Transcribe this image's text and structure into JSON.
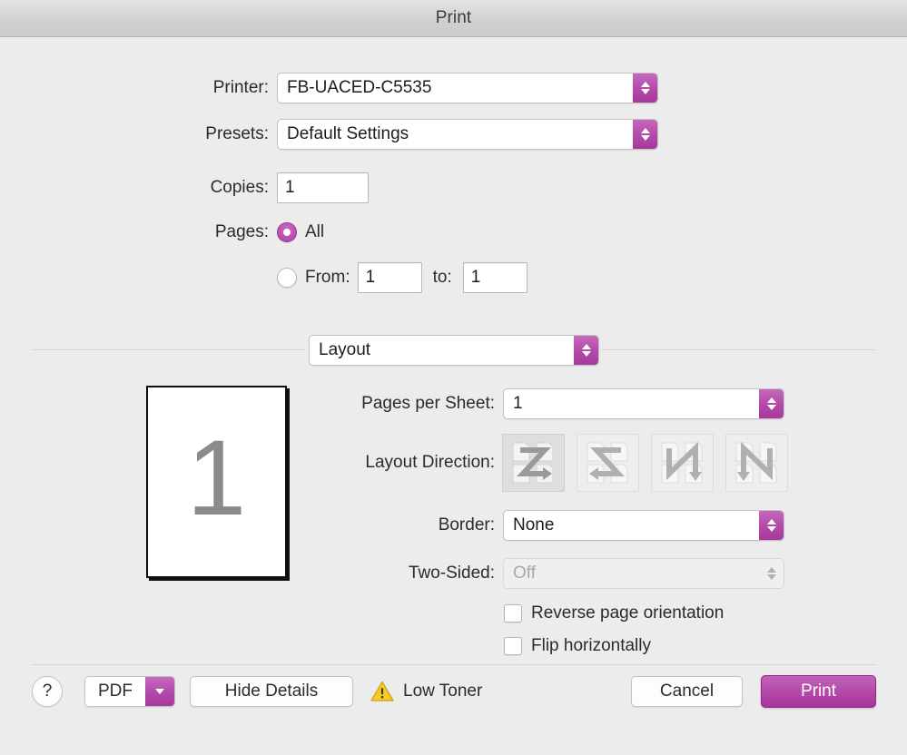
{
  "window": {
    "title": "Print"
  },
  "form": {
    "printer_label": "Printer:",
    "printer_value": "FB-UACED-C5535",
    "presets_label": "Presets:",
    "presets_value": "Default Settings",
    "copies_label": "Copies:",
    "copies_value": "1",
    "pages_label": "Pages:",
    "pages_all_label": "All",
    "pages_from_label": "From:",
    "pages_from_value": "1",
    "pages_to_label": "to:",
    "pages_to_value": "1",
    "pages_selected": "All"
  },
  "pane": {
    "selector_value": "Layout"
  },
  "preview": {
    "page_number": "1"
  },
  "layout": {
    "pages_per_sheet_label": "Pages per Sheet:",
    "pages_per_sheet_value": "1",
    "layout_direction_label": "Layout Direction:",
    "layout_direction_options": [
      "across-then-down-z",
      "across-then-down-reverse-z",
      "down-then-across-n",
      "down-then-across-reverse-n"
    ],
    "layout_direction_selected_index": 0,
    "border_label": "Border:",
    "border_value": "None",
    "two_sided_label": "Two-Sided:",
    "two_sided_value": "Off",
    "two_sided_disabled": true,
    "reverse_page_orientation_label": "Reverse page orientation",
    "reverse_page_orientation_checked": false,
    "flip_horizontally_label": "Flip horizontally",
    "flip_horizontally_checked": false
  },
  "toolbar": {
    "help_label": "?",
    "pdf_label": "PDF",
    "hide_details_label": "Hide Details",
    "status_label": "Low Toner",
    "cancel_label": "Cancel",
    "print_label": "Print"
  },
  "colors": {
    "accent": "#b44aa9",
    "window_bg": "#ececec",
    "warning": "#f5c518",
    "text": "#2b2b2b"
  }
}
